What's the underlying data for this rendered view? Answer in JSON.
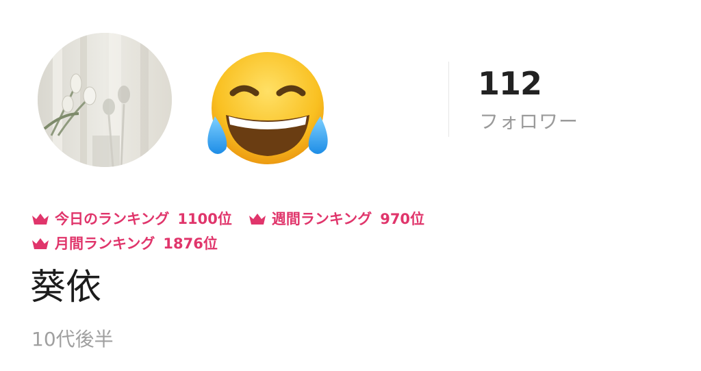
{
  "profile": {
    "avatar_icon": "profile-photo-flowers",
    "status_emoji": "face-with-tears-of-joy-icon",
    "name": "葵依",
    "age_group": "10代後半"
  },
  "stats": {
    "follower_count": "112",
    "follower_label": "フォロワー"
  },
  "rankings": [
    {
      "label": "今日のランキング",
      "value": "1100位"
    },
    {
      "label": "週間ランキング",
      "value": "970位"
    },
    {
      "label": "月間ランキング",
      "value": "1876位"
    }
  ],
  "colors": {
    "accent": "#e0356b",
    "name_text": "#1c1c1c",
    "muted_text": "#9a9a9a"
  }
}
